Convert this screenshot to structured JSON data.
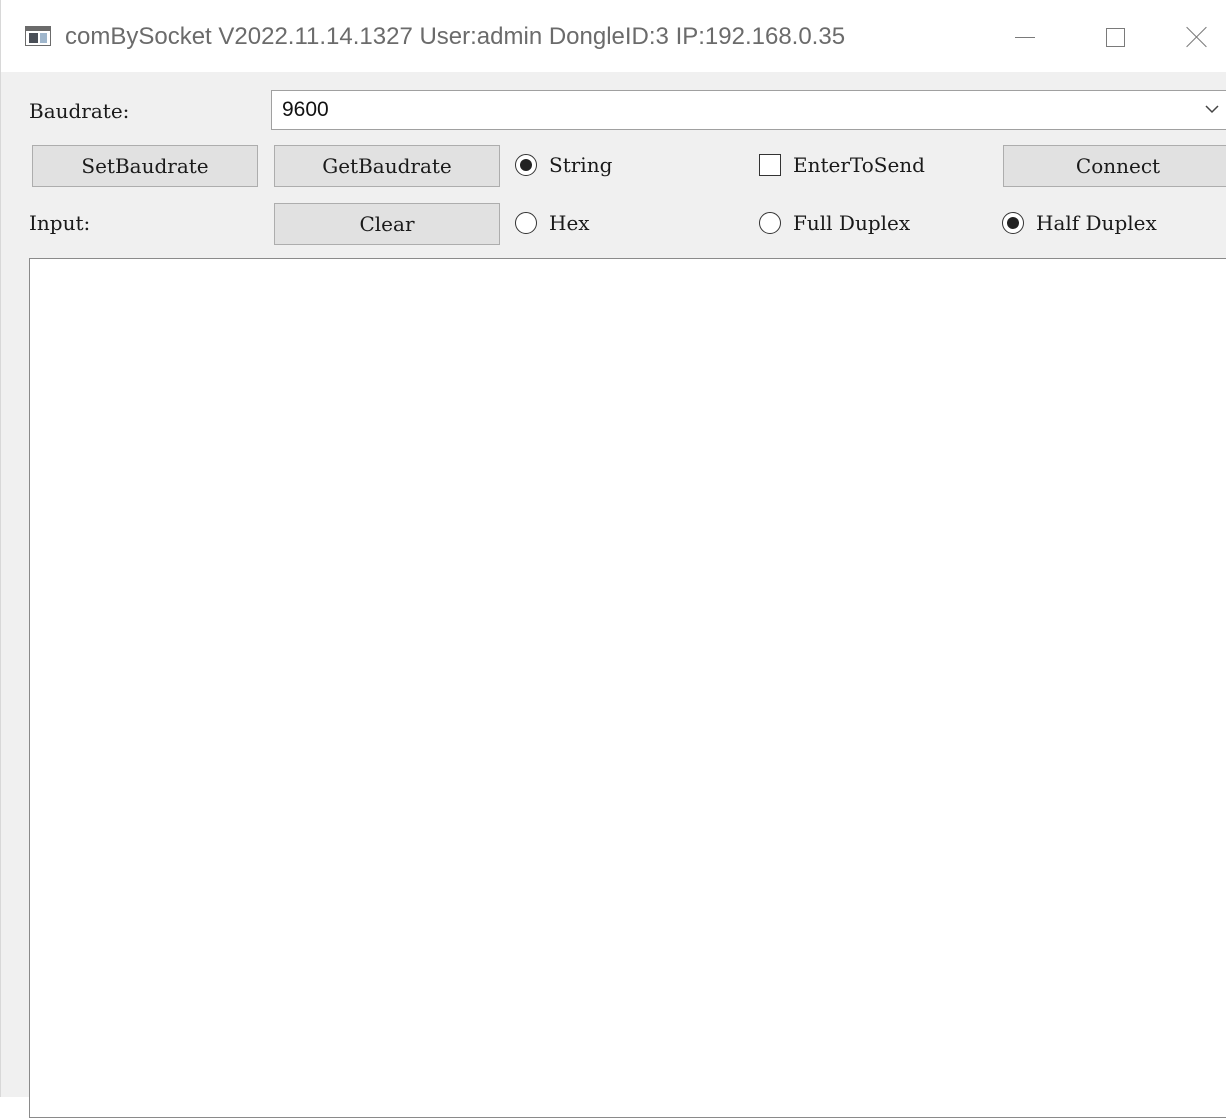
{
  "window": {
    "title": "comBySocket V2022.11.14.1327 User:admin DongleID:3 IP:192.168.0.35",
    "icons": [
      "app-icon",
      "minimize-icon",
      "maximize-icon",
      "close-icon"
    ]
  },
  "baudrate": {
    "label": "Baudrate:",
    "selected": "9600"
  },
  "buttons": {
    "set_baudrate": "SetBaudrate",
    "get_baudrate": "GetBaudrate",
    "connect": "Connect",
    "clear": "Clear"
  },
  "input": {
    "label": "Input:"
  },
  "format": {
    "string_label": "String",
    "hex_label": "Hex",
    "selected": "String"
  },
  "enter_to_send": {
    "label": "EnterToSend",
    "checked": false
  },
  "duplex": {
    "full_label": "Full Duplex",
    "half_label": "Half Duplex",
    "selected": "Half Duplex"
  },
  "output": {
    "content": ""
  }
}
